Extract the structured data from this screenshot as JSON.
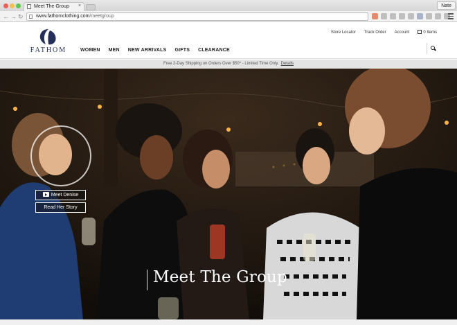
{
  "browser": {
    "tab_title": "Meet The Group",
    "tab_close": "×",
    "profile_name": "Nate",
    "url_host": "www.fathomclothing.com",
    "url_path": "/meetgroup",
    "back_glyph": "←",
    "forward_glyph": "→",
    "reload_glyph": "↻",
    "traffic_colors": [
      "#ee5f58",
      "#f6be4f",
      "#5fc553"
    ]
  },
  "site": {
    "logo_text": "FATHOM",
    "logo_color": "#24305a",
    "main_nav": [
      "WOMEN",
      "MEN",
      "NEW ARRIVALS",
      "GIFTS",
      "CLEARANCE"
    ],
    "util_nav": {
      "store_locator": "Store Locator",
      "track_order": "Track Order",
      "account": "Account",
      "cart": "0 Items"
    },
    "promo": {
      "text": "Free 2-Day Shipping on Orders Over $50* - Limited Time Only.",
      "link": "Details"
    }
  },
  "hero": {
    "meet_button": "Meet Denise",
    "story_button": "Read Her Story",
    "title": "Meet The Group"
  },
  "icons": [
    "page-icon",
    "back-arrow-icon",
    "forward-arrow-icon",
    "reload-icon",
    "hamburger-menu-icon",
    "shopping-bag-icon",
    "search-icon",
    "play-icon"
  ]
}
